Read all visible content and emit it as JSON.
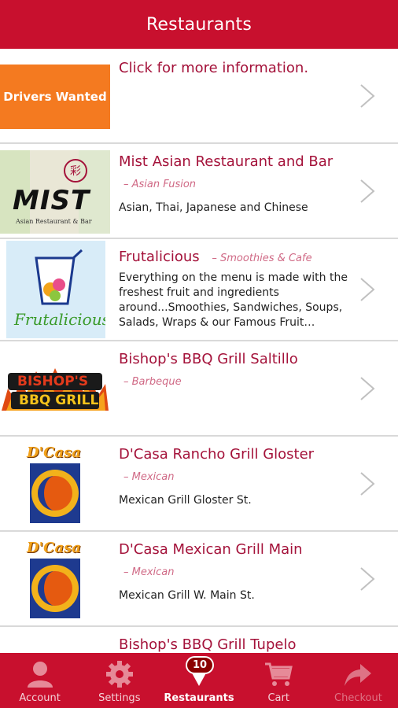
{
  "header": {
    "title": "Restaurants"
  },
  "rows": [
    {
      "image_text": "Drivers Wanted",
      "title": "Click for more information.",
      "category": "",
      "description": ""
    },
    {
      "image_text": "MIST",
      "image_subtext": "Asian Restaurant & Bar",
      "title": "Mist Asian Restaurant and Bar",
      "category": "–  Asian Fusion",
      "description": "Asian, Thai, Japanese and Chinese"
    },
    {
      "image_text": "Frutalicious",
      "title": "Frutalicious",
      "category": "–  Smoothies & Cafe",
      "description": "Everything on the menu is made with the freshest fruit and ingredients around...Smoothies, Sandwiches, Soups, Salads, Wraps & our Famous Fruit…"
    },
    {
      "image_text": "BISHOP'S",
      "image_subtext": "BBQ GRILL",
      "title": "Bishop's BBQ Grill Saltillo",
      "category": "–  Barbeque",
      "description": ""
    },
    {
      "image_text": "D'Casa",
      "title": "D'Casa Rancho Grill Gloster",
      "category": "–  Mexican",
      "description": "Mexican Grill Gloster St."
    },
    {
      "image_text": "D'Casa",
      "title": "D'Casa Mexican Grill Main",
      "category": "–  Mexican",
      "description": "Mexican Grill W. Main St."
    },
    {
      "title": "Bishop's BBQ Grill Tupelo"
    }
  ],
  "tabbar": {
    "tabs": [
      {
        "label": "Account",
        "icon": "person-icon"
      },
      {
        "label": "Settings",
        "icon": "gear-icon"
      },
      {
        "label": "Restaurants",
        "icon": "down-arrow-icon",
        "badge": "10"
      },
      {
        "label": "Cart",
        "icon": "cart-icon"
      },
      {
        "label": "Checkout",
        "icon": "share-arrow-icon"
      }
    ]
  },
  "colors": {
    "brand_red": "#c8102e",
    "title_color": "#a4123a",
    "category_color": "#d06a86"
  }
}
